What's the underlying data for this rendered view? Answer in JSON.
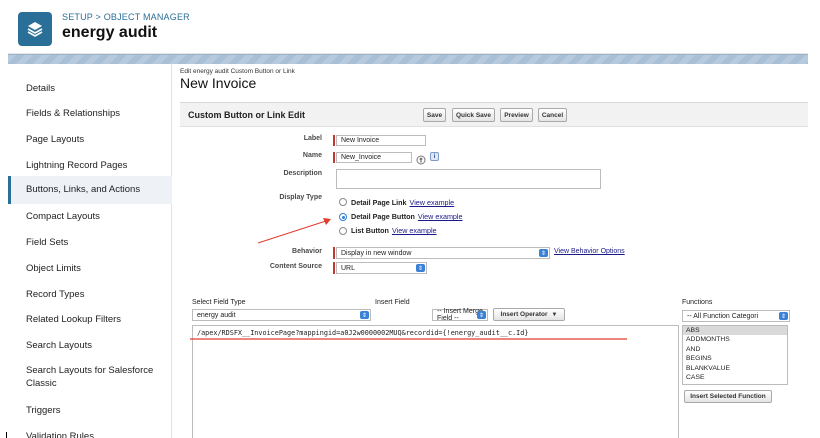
{
  "header": {
    "breadcrumb": "SETUP > OBJECT MANAGER",
    "object_name": "energy audit"
  },
  "sidebar": {
    "items": [
      {
        "label": "Details"
      },
      {
        "label": "Fields & Relationships"
      },
      {
        "label": "Page Layouts"
      },
      {
        "label": "Lightning Record Pages"
      },
      {
        "label": "Buttons, Links, and Actions"
      },
      {
        "label": "Compact Layouts"
      },
      {
        "label": "Field Sets"
      },
      {
        "label": "Object Limits"
      },
      {
        "label": "Record Types"
      },
      {
        "label": "Related Lookup Filters"
      },
      {
        "label": "Search Layouts"
      },
      {
        "label": "Search Layouts for Salesforce Classic"
      },
      {
        "label": "Triggers"
      },
      {
        "label": "Validation Rules"
      }
    ],
    "active_index": 4
  },
  "main": {
    "sub_crumb": "Edit energy audit Custom Button or Link",
    "heading": "New Invoice",
    "panel_title": "Custom Button or Link Edit",
    "buttons": {
      "save": "Save",
      "quick_save": "Quick Save",
      "preview": "Preview",
      "cancel": "Cancel"
    },
    "fields": {
      "label_label": "Label",
      "label_value": "New Invoice",
      "name_label": "Name",
      "name_value": "New_Invoice",
      "description_label": "Description",
      "description_value": "",
      "display_type_label": "Display Type",
      "display_options": [
        {
          "label": "Detail Page Link",
          "link": "View example",
          "checked": false
        },
        {
          "label": "Detail Page Button",
          "link": "View example",
          "checked": true
        },
        {
          "label": "List Button",
          "link": "View example",
          "checked": false
        }
      ],
      "behavior_label": "Behavior",
      "behavior_value": "Display in new window",
      "behavior_link": "View Behavior Options",
      "content_source_label": "Content Source",
      "content_source_value": "URL"
    },
    "formula_builder": {
      "select_field_type_label": "Select Field Type",
      "field_type_value": "energy audit",
      "insert_field_label": "Insert Field",
      "merge_field_value": "-- Insert Merge Field --",
      "insert_operator": "Insert Operator",
      "functions_label": "Functions",
      "functions_category": "-- All Function Categori",
      "formula_text": "/apex/RDSFX__InvoicePage?mappingid=a0J2w0000002MUQ&recordid={!energy_audit__c.Id}",
      "functions": [
        "ABS",
        "ADDMONTHS",
        "AND",
        "BEGINS",
        "BLANKVALUE",
        "CASE"
      ],
      "insert_selected_function": "Insert Selected Function"
    },
    "accent_colors": {
      "brand": "#2a6f97",
      "required": "#c23934",
      "annotation": "#e03c2f"
    }
  }
}
